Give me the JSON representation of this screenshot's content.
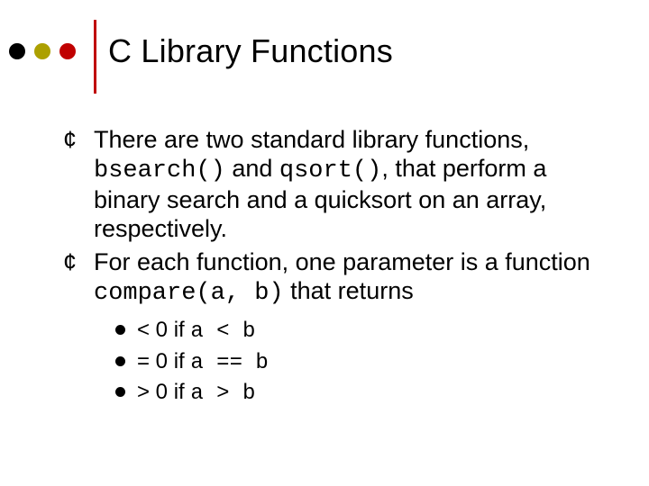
{
  "title": "C Library Functions",
  "bullets": {
    "b1": {
      "t1": "There are two standard library functions, ",
      "c1": "bsearch()",
      "t2": " and ",
      "c2": "qsort()",
      "t3": ", that perform a binary search and a quicksort on an array, respectively."
    },
    "b2": {
      "t1": "For each function, one parameter is a function ",
      "c1": "compare(a, b)",
      "t2": " that returns"
    }
  },
  "sub": {
    "s1": {
      "lead": "< 0 if ",
      "code": "a < b"
    },
    "s2": {
      "lead": "= 0 if ",
      "code": "a == b"
    },
    "s3": {
      "lead": "> 0 if ",
      "code": "a > b"
    }
  }
}
